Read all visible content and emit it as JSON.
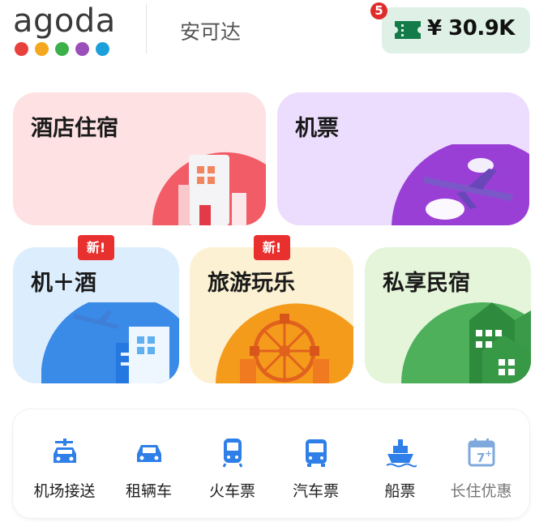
{
  "header": {
    "logo_text": "agoda",
    "logo_dot_colors": [
      "#e8413c",
      "#f4a81d",
      "#3cb14a",
      "#9b4fb8",
      "#1ca0dc"
    ],
    "subbrand": "安可达",
    "wallet_amount": "¥ 30.9K",
    "notification_count": "5"
  },
  "cards": {
    "hotel": {
      "title": "酒店住宿"
    },
    "flight": {
      "title": "机票"
    },
    "bundle": {
      "title": "机＋酒",
      "badge": "新!"
    },
    "activity": {
      "title": "旅游玩乐",
      "badge": "新!"
    },
    "home": {
      "title": "私享民宿"
    }
  },
  "services": [
    {
      "label": "机场接送",
      "icon": "airport-car-icon"
    },
    {
      "label": "租辆车",
      "icon": "car-icon"
    },
    {
      "label": "火车票",
      "icon": "train-icon"
    },
    {
      "label": "汽车票",
      "icon": "bus-icon"
    },
    {
      "label": "船票",
      "icon": "ship-icon"
    },
    {
      "label": "长住优惠",
      "icon": "calendar-7-icon"
    }
  ],
  "colors": {
    "accent_blue": "#2f7fe8",
    "wallet_bg": "#dff1e6",
    "badge_red": "#e8302f"
  }
}
